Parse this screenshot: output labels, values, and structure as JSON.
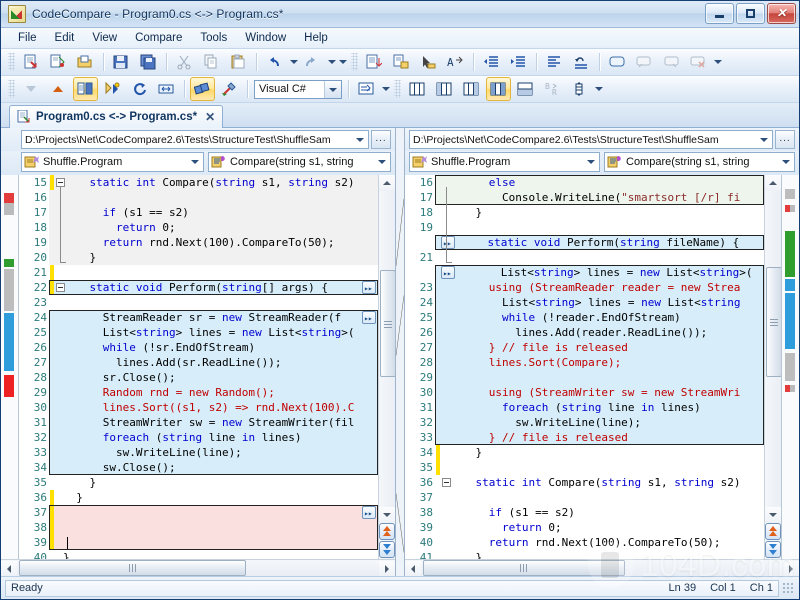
{
  "window": {
    "title": "CodeCompare - Program0.cs <-> Program.cs*",
    "icon": "codecompare-icon",
    "minimize_label": "–",
    "maximize_label": "□",
    "close_label": "✕"
  },
  "menu": [
    {
      "label": "File"
    },
    {
      "label": "Edit"
    },
    {
      "label": "View"
    },
    {
      "label": "Compare"
    },
    {
      "label": "Tools"
    },
    {
      "label": "Window"
    },
    {
      "label": "Help"
    }
  ],
  "toolbar_row1": [
    {
      "name": "new-comparison-icon",
      "active": false
    },
    {
      "name": "compare-folders-icon",
      "active": false
    },
    {
      "name": "open-file-icon",
      "active": false
    },
    {
      "name": "save-icon",
      "active": false
    },
    {
      "name": "save-all-icon",
      "active": false
    },
    {
      "name": "cut-icon",
      "active": false
    },
    {
      "name": "copy-icon",
      "active": false
    },
    {
      "name": "paste-icon",
      "active": false
    },
    {
      "name": "undo-icon",
      "active": false
    },
    {
      "name": "redo-icon",
      "active": false
    },
    {
      "name": "toolbar-overflow-icon",
      "active": false
    },
    {
      "name": "insert-block-icon",
      "active": false
    },
    {
      "name": "replace-block-icon",
      "active": false
    },
    {
      "name": "select-block-icon",
      "active": false
    },
    {
      "name": "format-text-icon",
      "active": false
    },
    {
      "name": "outdent-icon",
      "active": false
    },
    {
      "name": "indent-icon",
      "active": false
    },
    {
      "name": "align-left-icon",
      "active": false
    },
    {
      "name": "restore-line-icon",
      "active": false
    },
    {
      "name": "comment-balloon-icon",
      "active": false
    },
    {
      "name": "comment-prev-icon",
      "active": false
    },
    {
      "name": "comment-next-icon",
      "active": false
    },
    {
      "name": "comment-delete-icon",
      "active": false
    },
    {
      "name": "toolbar-more-icon",
      "active": false
    }
  ],
  "toolbar_row2": {
    "buttons_left": [
      {
        "name": "next-difference-icon",
        "active": false
      },
      {
        "name": "prev-difference-icon",
        "active": false
      },
      {
        "name": "synchronize-scroll-icon",
        "active": true
      },
      {
        "name": "refresh-structure-icon",
        "active": false
      },
      {
        "name": "recompare-icon",
        "active": false
      },
      {
        "name": "fit-width-icon",
        "active": false
      },
      {
        "name": "highlight-differences-icon",
        "active": true
      },
      {
        "name": "merge-tool-icon",
        "active": false
      }
    ],
    "language_combo": {
      "value": "Visual C#",
      "name": "language-select"
    },
    "buttons_mid": [
      {
        "name": "whitespace-icon",
        "active": false
      },
      {
        "name": "whitespace-dropdown-icon",
        "active": false
      }
    ],
    "view_buttons": [
      {
        "name": "view-left-only-icon",
        "active": false
      },
      {
        "name": "view-split-icon",
        "active": false
      },
      {
        "name": "view-right-only-icon",
        "active": false
      },
      {
        "name": "view-side-by-side-icon",
        "active": true
      },
      {
        "name": "view-horizontal-icon",
        "active": false
      },
      {
        "name": "view-inline-icon",
        "active": false
      },
      {
        "name": "view-vertical-icon",
        "active": false
      }
    ],
    "overflow": {
      "name": "toolbar-more-icon"
    }
  },
  "tab": {
    "label": "Program0.cs <-> Program.cs*",
    "icon": "document-compare-icon",
    "close_label": "✕"
  },
  "left_pane": {
    "path": "D:\\Projects\\Net\\CodeCompare2.6\\Tests\\StructureTest\\ShuffleSam",
    "browse_label": "...",
    "type_combo": "Shuffle.Program",
    "member_combo": "Compare(string s1, string",
    "first_line": 15,
    "lines": [
      {
        "n": 15,
        "text": "    static int Compare(string s1, string s2)",
        "block": "eq",
        "mark": true,
        "fold": "start"
      },
      {
        "n": 16,
        "text": "",
        "block": "eq"
      },
      {
        "n": 17,
        "text": "      if (s1 == s2)",
        "block": "eq"
      },
      {
        "n": 18,
        "text": "        return 0;",
        "block": "eq"
      },
      {
        "n": 19,
        "text": "      return rnd.Next(100).CompareTo(50);",
        "block": "eq"
      },
      {
        "n": 20,
        "text": "    }",
        "block": "eq"
      },
      {
        "n": 21,
        "text": "",
        "block": "none",
        "mark": true
      },
      {
        "n": 22,
        "text": "    static void Perform(string[] args) {",
        "block": "add",
        "mark": true,
        "fold": "start",
        "expander": true
      },
      {
        "n": 23,
        "text": "",
        "block": "none"
      },
      {
        "n": 24,
        "text": "      StreamReader sr = new StreamReader(f",
        "block": "add",
        "expander": true
      },
      {
        "n": 25,
        "text": "      List<string> lines = new List<string>(",
        "block": "add"
      },
      {
        "n": 26,
        "text": "      while (!sr.EndOfStream)",
        "block": "add"
      },
      {
        "n": 27,
        "text": "        lines.Add(sr.ReadLine());",
        "block": "add"
      },
      {
        "n": 28,
        "text": "      sr.Close();",
        "block": "add"
      },
      {
        "n": 29,
        "text": "      Random rnd = new Random();",
        "block": "add",
        "changed": true
      },
      {
        "n": 30,
        "text": "      lines.Sort((s1, s2) => rnd.Next(100).C",
        "block": "add",
        "changed": true
      },
      {
        "n": 31,
        "text": "      StreamWriter sw = new StreamWriter(fil",
        "block": "add"
      },
      {
        "n": 32,
        "text": "      foreach (string line in lines)",
        "block": "add"
      },
      {
        "n": 33,
        "text": "        sw.WriteLine(line);",
        "block": "add"
      },
      {
        "n": 34,
        "text": "      sw.Close();",
        "block": "add"
      },
      {
        "n": 35,
        "text": "    }",
        "block": "none"
      },
      {
        "n": 36,
        "text": "  }",
        "block": "none",
        "mark": true
      },
      {
        "n": 37,
        "text": "",
        "block": "del",
        "mark": true,
        "expander": true
      },
      {
        "n": 38,
        "text": "",
        "block": "del",
        "mark": true
      },
      {
        "n": 39,
        "text": "",
        "block": "del",
        "mark": true,
        "caret": true
      },
      {
        "n": 40,
        "text": "}",
        "block": "none"
      }
    ]
  },
  "right_pane": {
    "path": "D:\\Projects\\Net\\CodeCompare2.6\\Tests\\StructureTest\\ShuffleSam",
    "browse_label": "...",
    "type_combo": "Shuffle.Program",
    "member_combo": "Compare(string s1, string",
    "first_line": 16,
    "lines": [
      {
        "n": 16,
        "text": "      else",
        "block": "ctx"
      },
      {
        "n": 17,
        "text": "        Console.WriteLine(\"smartsort [/r] fi",
        "block": "ctx"
      },
      {
        "n": 18,
        "text": "    }",
        "block": "none"
      },
      {
        "n": 19,
        "text": "",
        "block": "none"
      },
      {
        "n": 20,
        "text": "    static void Perform(string fileName) {",
        "block": "add",
        "fold": "start",
        "expander": true,
        "hidenum": true
      },
      {
        "n": 21,
        "text": "",
        "block": "none"
      },
      {
        "n": 22,
        "text": "      List<string> lines = new List<string>(",
        "block": "add",
        "expander": true,
        "hidenum": true
      },
      {
        "n": 23,
        "text": "      using (StreamReader reader = new Strea",
        "block": "add",
        "changed": true
      },
      {
        "n": 24,
        "text": "        List<string> lines = new List<string",
        "block": "add"
      },
      {
        "n": 25,
        "text": "        while (!reader.EndOfStream)",
        "block": "add"
      },
      {
        "n": 26,
        "text": "          lines.Add(reader.ReadLine());",
        "block": "add"
      },
      {
        "n": 27,
        "text": "      } // file is released",
        "block": "add",
        "comment": true
      },
      {
        "n": 28,
        "text": "      lines.Sort(Compare);",
        "block": "add",
        "changed": true
      },
      {
        "n": 29,
        "text": "",
        "block": "add"
      },
      {
        "n": 30,
        "text": "      using (StreamWriter sw = new StreamWri",
        "block": "add",
        "changed": true
      },
      {
        "n": 31,
        "text": "        foreach (string line in lines)",
        "block": "add"
      },
      {
        "n": 32,
        "text": "          sw.WriteLine(line);",
        "block": "add"
      },
      {
        "n": 33,
        "text": "      } // file is released",
        "block": "add",
        "comment": true
      },
      {
        "n": 34,
        "text": "    }",
        "block": "none",
        "mark": true
      },
      {
        "n": 35,
        "text": "",
        "block": "none",
        "mark": true
      },
      {
        "n": 36,
        "text": "    static int Compare(string s1, string s2)",
        "block": "none",
        "fold": "start"
      },
      {
        "n": 37,
        "text": "",
        "block": "none"
      },
      {
        "n": 38,
        "text": "      if (s1 == s2)",
        "block": "none"
      },
      {
        "n": 39,
        "text": "        return 0;",
        "block": "none"
      },
      {
        "n": 40,
        "text": "      return rnd.Next(100).CompareTo(50);",
        "block": "none"
      },
      {
        "n": 41,
        "text": "    }",
        "block": "none"
      }
    ]
  },
  "statusbar": {
    "message": "Ready",
    "line": "Ln 39",
    "column": "Col 1",
    "character": "Ch 1"
  },
  "colors": {
    "added": "#d7eefa",
    "deleted": "#fbe0e0",
    "context": "#eef5ec",
    "equal": "#f1f1f1",
    "changed_text": "#c00000",
    "keyword": "#0000d0",
    "highlight": "#a9ddee",
    "accent": "#2b5797"
  },
  "watermark": "104D.com"
}
